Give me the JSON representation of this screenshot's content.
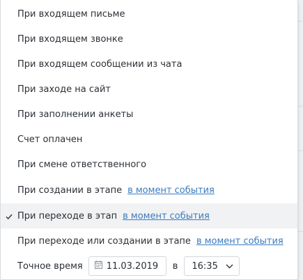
{
  "menu": {
    "items": [
      {
        "label": "При входящем письме",
        "link": ""
      },
      {
        "label": "При входящем звонке",
        "link": ""
      },
      {
        "label": "При входящем сообщении из чата",
        "link": ""
      },
      {
        "label": "При заходе на сайт",
        "link": ""
      },
      {
        "label": "При заполнении анкеты",
        "link": ""
      },
      {
        "label": "Счет оплачен",
        "link": ""
      },
      {
        "label": "При смене ответственного",
        "link": ""
      },
      {
        "label": "При создании в этапе",
        "link": "в момент события"
      },
      {
        "label": "При переходе в этап",
        "link": "в момент события",
        "selected": true
      },
      {
        "label": "При переходе или создании в этапе",
        "link": "в момент события"
      }
    ]
  },
  "exact_time": {
    "label": "Точное время",
    "date": "11.03.2019",
    "in_word": "в",
    "time": "16:35"
  },
  "icons": {
    "check": "check-icon",
    "calendar": "calendar-icon",
    "dropdown": "chevron-down-icon"
  },
  "colors": {
    "link": "#3a7bbf",
    "selected_bg": "#f1f2f3",
    "text": "#2b3036"
  }
}
